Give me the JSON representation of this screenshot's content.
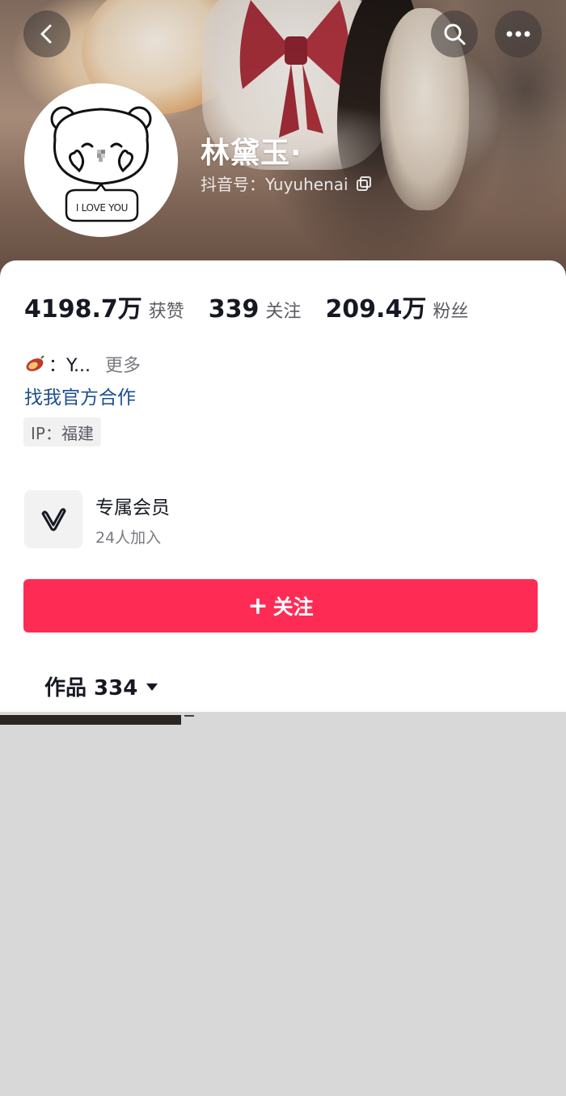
{
  "header": {
    "name": "林黛玉·",
    "douyin_id": "抖音号：Yuyuhenai",
    "avatar_text": "I LOVE YOU"
  },
  "top_buttons": {
    "back_icon": "chevron-left-icon",
    "search_icon": "search-icon",
    "more_icon": "more-icon"
  },
  "stats": [
    {
      "value": "4198.7万",
      "label": "获赞"
    },
    {
      "value": "339",
      "label": "关注"
    },
    {
      "value": "209.4万",
      "label": "粉丝"
    }
  ],
  "bio": {
    "emoji": "sweet-potato-icon",
    "text": "：Y...",
    "more": "更多",
    "cooperation_link": "找我官方合作",
    "ip": "IP：福建"
  },
  "member": {
    "title": "专属会员",
    "subtitle": "24人加入"
  },
  "follow_button": {
    "plus": "+",
    "label": "关注",
    "color": "#fe2c55"
  },
  "tabs": {
    "works": "作品 334"
  }
}
